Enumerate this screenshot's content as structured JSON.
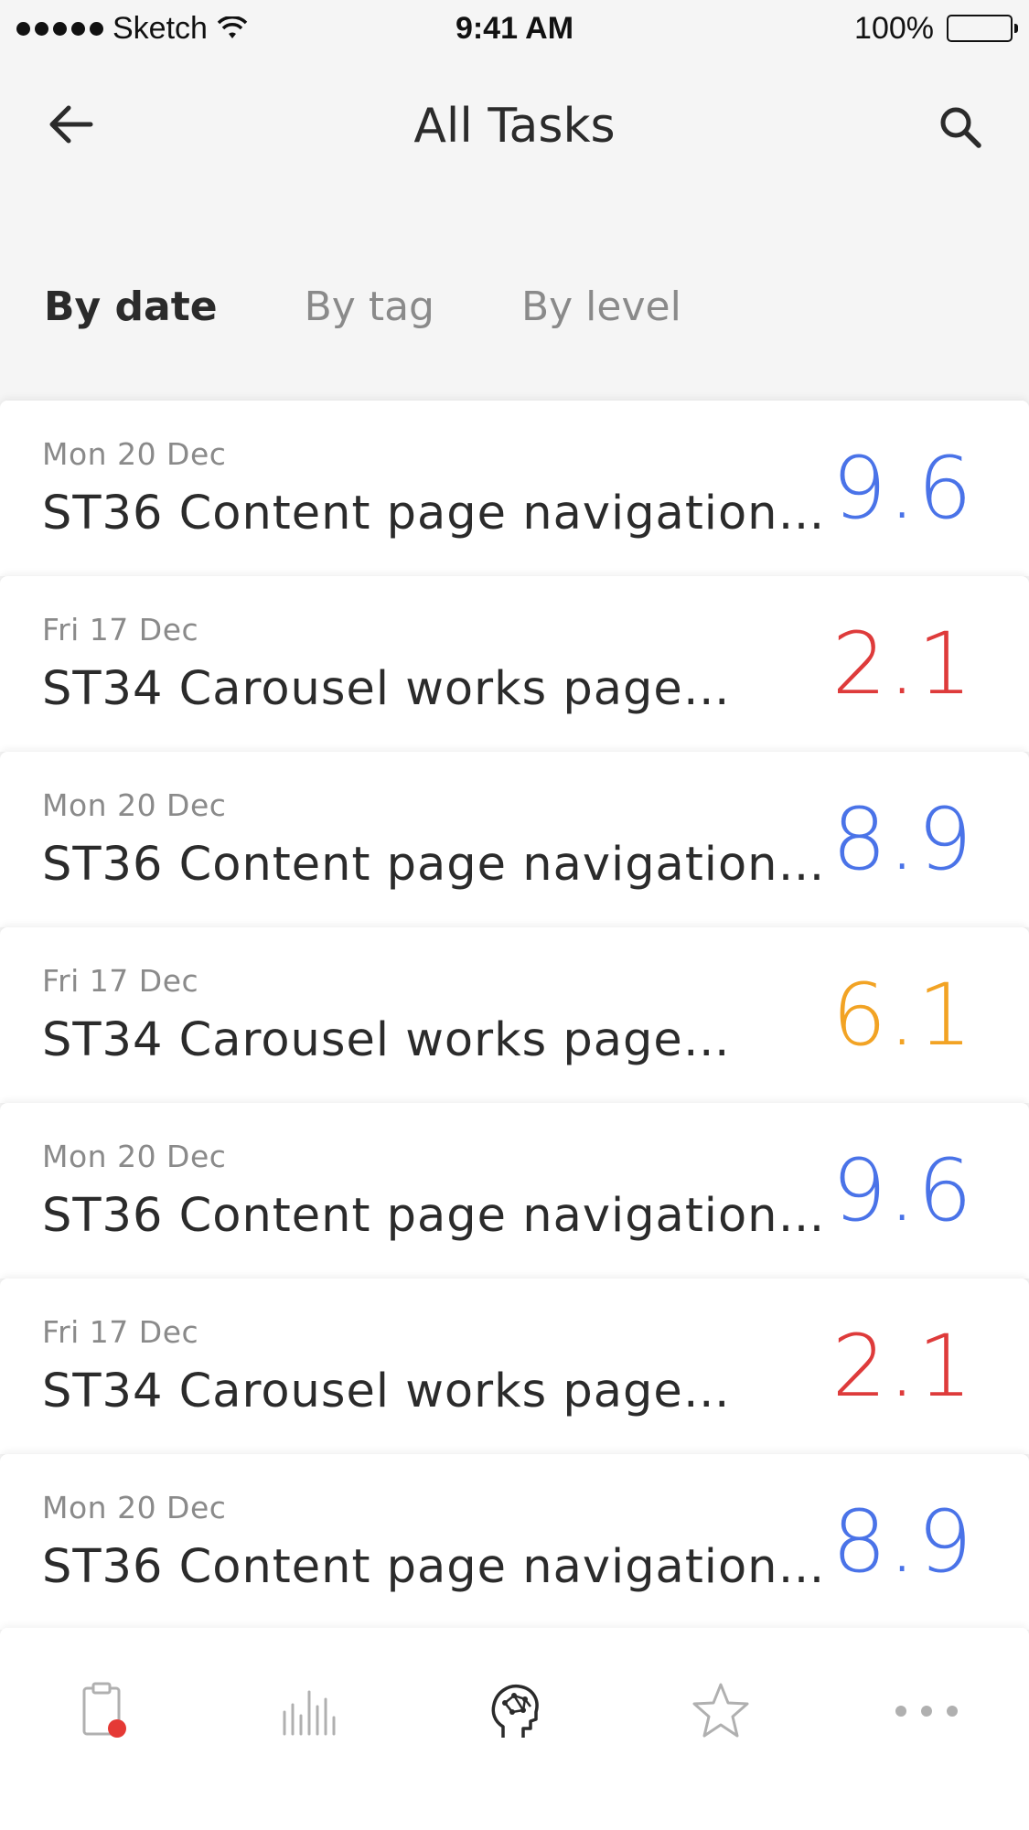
{
  "status_bar": {
    "carrier": "Sketch",
    "time": "9:41 AM",
    "battery": "100%"
  },
  "nav": {
    "title": "All Tasks",
    "back_icon": "arrow-left-icon",
    "search_icon": "search-icon"
  },
  "tabs": [
    {
      "label": "By date",
      "active": true
    },
    {
      "label": "By tag",
      "active": false
    },
    {
      "label": "By level",
      "active": false
    }
  ],
  "tasks": [
    {
      "date": "Mon 20 Dec",
      "title": "ST36 Content page navigation…",
      "score": "9.6",
      "color": "#4a73e8"
    },
    {
      "date": "Fri 17 Dec",
      "title": "ST34 Carousel works page…",
      "score": "2.1",
      "color": "#de3b3b"
    },
    {
      "date": "Mon 20 Dec",
      "title": "ST36 Content page navigation…",
      "score": "8.9",
      "color": "#4a73e8"
    },
    {
      "date": "Fri 17 Dec",
      "title": "ST34 Carousel works page…",
      "score": "6.1",
      "color": "#f2a324"
    },
    {
      "date": "Mon 20 Dec",
      "title": "ST36 Content page navigation…",
      "score": "9.6",
      "color": "#4a73e8"
    },
    {
      "date": "Fri 17 Dec",
      "title": "ST34 Carousel works page…",
      "score": "2.1",
      "color": "#de3b3b"
    },
    {
      "date": "Mon 20 Dec",
      "title": "ST36 Content page navigation…",
      "score": "8.9",
      "color": "#4a73e8"
    }
  ],
  "tab_bar": {
    "items": [
      {
        "icon": "clipboard-icon",
        "active": false
      },
      {
        "icon": "bar-chart-icon",
        "active": false
      },
      {
        "icon": "head-brain-icon",
        "active": true
      },
      {
        "icon": "star-icon",
        "active": false
      },
      {
        "icon": "more-dots-icon",
        "active": false
      }
    ],
    "badge_color": "#e53935"
  }
}
